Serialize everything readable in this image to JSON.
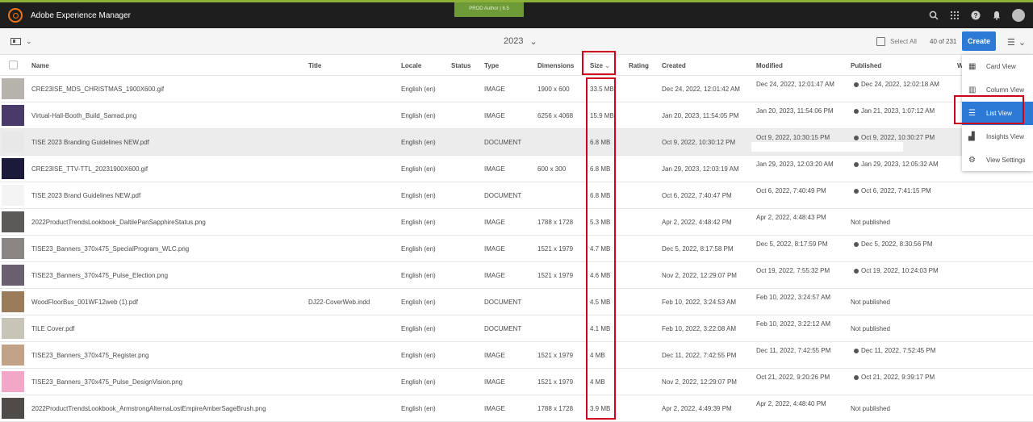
{
  "app": {
    "title": "Adobe Experience Manager",
    "env_badge": "PROD Author | 6.5"
  },
  "top_icons": [
    "search-icon",
    "apps-grid-icon",
    "help-icon",
    "bell-icon",
    "user-avatar"
  ],
  "actionbar": {
    "folder_title": "2023",
    "folder_chevron": "⌄",
    "rail_chevron": "⌄",
    "select_all_label": "Select All",
    "count_label": "40 of 231",
    "create_label": "Create",
    "view_chevron": "⌄"
  },
  "columns": {
    "name": "Name",
    "title": "Title",
    "locale": "Locale",
    "status": "Status",
    "type": "Type",
    "dimensions": "Dimensions",
    "size": "Size",
    "size_sort": "⌄",
    "rating": "Rating",
    "created": "Created",
    "modified": "Modified",
    "published": "Published",
    "workflow": "W"
  },
  "rows": [
    {
      "name": "CRE23ISE_MDS_CHRISTMAS_1900X600.gif",
      "title": "",
      "locale": "English (en)",
      "type": "IMAGE",
      "dimensions": "1900 x 600",
      "size": "33.5 MB",
      "created": "Dec 24, 2022, 12:01:42 AM",
      "modified": "Dec 24, 2022, 12:01:47 AM",
      "published": "Dec 24, 2022, 12:02:18 AM",
      "thumb": "#b8b2ad"
    },
    {
      "name": "Virtual-Hall-Booth_Build_Samad.png",
      "title": "",
      "locale": "English (en)",
      "type": "IMAGE",
      "dimensions": "6256 x 4068",
      "size": "15.9 MB",
      "created": "Jan 20, 2023, 11:54:05 PM",
      "modified": "Jan 20, 2023, 11:54:06 PM",
      "published": "Jan 21, 2023, 1:07:12 AM",
      "thumb": "#4a3a6a"
    },
    {
      "name": "TISE 2023 Branding Guidelines NEW.pdf",
      "title": "",
      "locale": "English (en)",
      "type": "DOCUMENT",
      "dimensions": "",
      "size": "6.8 MB",
      "created": "Oct 9, 2022, 10:30:12 PM",
      "modified": "Oct 9, 2022, 10:30:15 PM",
      "published": "Oct 9, 2022, 10:30:27 PM",
      "thumb": "#e8e8e8"
    },
    {
      "name": "CRE23ISE_TTV-TTL_20231900X600.gif",
      "title": "",
      "locale": "English (en)",
      "type": "IMAGE",
      "dimensions": "600 x 300",
      "size": "6.8 MB",
      "created": "Jan 29, 2023, 12:03:19 AM",
      "modified": "Jan 29, 2023, 12:03:20 AM",
      "published": "Jan 29, 2023, 12:05:32 AM",
      "thumb": "#1c1a3a"
    },
    {
      "name": "TISE 2023 Brand Guidelines NEW.pdf",
      "title": "",
      "locale": "English (en)",
      "type": "DOCUMENT",
      "dimensions": "",
      "size": "6.8 MB",
      "created": "Oct 6, 2022, 7:40:47 PM",
      "modified": "Oct 6, 2022, 7:40:49 PM",
      "published": "Oct 6, 2022, 7:41:15 PM",
      "thumb": "#f4f4f4"
    },
    {
      "name": "2022ProductTrendsLookbook_DaltilePanSapphireStatus.png",
      "title": "",
      "locale": "English (en)",
      "type": "IMAGE",
      "dimensions": "1788 x 1728",
      "size": "5.3 MB",
      "created": "Apr 2, 2022, 4:48:42 PM",
      "modified": "Apr 2, 2022, 4:48:43 PM",
      "published": "Not published",
      "thumb": "#5c5a58"
    },
    {
      "name": "TISE23_Banners_370x475_SpecialProgram_WLC.png",
      "title": "",
      "locale": "English (en)",
      "type": "IMAGE",
      "dimensions": "1521 x 1979",
      "size": "4.7 MB",
      "created": "Dec 5, 2022, 8:17:58 PM",
      "modified": "Dec 5, 2022, 8:17:59 PM",
      "published": "Dec 5, 2022, 8:30:56 PM",
      "thumb": "#8a8684"
    },
    {
      "name": "TISE23_Banners_370x475_Pulse_Election.png",
      "title": "",
      "locale": "English (en)",
      "type": "IMAGE",
      "dimensions": "1521 x 1979",
      "size": "4.6 MB",
      "created": "Nov 2, 2022, 12:29:07 PM",
      "modified": "Oct 19, 2022, 7:55:32 PM",
      "published": "Oct 19, 2022, 10:24:03 PM",
      "thumb": "#6a5f6e"
    },
    {
      "name": "WoodFloorBus_001WF12web (1).pdf",
      "title": "DJ22-CoverWeb.indd",
      "locale": "English (en)",
      "type": "DOCUMENT",
      "dimensions": "",
      "size": "4.5 MB",
      "created": "Feb 10, 2022, 3:24:53 AM",
      "modified": "Feb 10, 2022, 3:24:57 AM",
      "published": "Not published",
      "thumb": "#9a7b5a"
    },
    {
      "name": "TILE Cover.pdf",
      "title": "",
      "locale": "English (en)",
      "type": "DOCUMENT",
      "dimensions": "",
      "size": "4.1 MB",
      "created": "Feb 10, 2022, 3:22:08 AM",
      "modified": "Feb 10, 2022, 3:22:12 AM",
      "published": "Not published",
      "thumb": "#c9c4b8"
    },
    {
      "name": "TISE23_Banners_370x475_Register.png",
      "title": "",
      "locale": "English (en)",
      "type": "IMAGE",
      "dimensions": "1521 x 1979",
      "size": "4 MB",
      "created": "Dec 11, 2022, 7:42:55 PM",
      "modified": "Dec 11, 2022, 7:42:55 PM",
      "published": "Dec 11, 2022, 7:52:45 PM",
      "thumb": "#c2a286"
    },
    {
      "name": "TISE23_Banners_370x475_Pulse_DesignVision.png",
      "title": "",
      "locale": "English (en)",
      "type": "IMAGE",
      "dimensions": "1521 x 1979",
      "size": "4 MB",
      "created": "Nov 2, 2022, 12:29:07 PM",
      "modified": "Oct 21, 2022, 9:20:26 PM",
      "published": "Oct 21, 2022, 9:39:17 PM",
      "thumb": "#f2a7c9"
    },
    {
      "name": "2022ProductTrendsLookbook_ArmstrongAlternaLostEmpireAmberSageBrush.png",
      "title": "",
      "locale": "English (en)",
      "type": "IMAGE",
      "dimensions": "1788 x 1728",
      "size": "3.9 MB",
      "created": "Apr 2, 2022, 4:49:39 PM",
      "modified": "Apr 2, 2022, 4:48:40 PM",
      "published": "Not published",
      "thumb": "#4e4b48"
    }
  ],
  "view_menu": [
    {
      "label": "Card View",
      "icon": "card-view-icon",
      "glyph": "▦",
      "selected": false
    },
    {
      "label": "Column View",
      "icon": "column-view-icon",
      "glyph": "▥",
      "selected": false
    },
    {
      "label": "List View",
      "icon": "list-view-icon",
      "glyph": "☰",
      "selected": true
    },
    {
      "label": "Insights View",
      "icon": "insights-view-icon",
      "glyph": "▟",
      "selected": false
    },
    {
      "label": "View Settings",
      "icon": "gear-icon",
      "glyph": "⚙",
      "selected": false
    }
  ],
  "colors": {
    "accent": "#2c7ad6",
    "highlight_red": "#d0021b",
    "topbar": "#1e1e1e",
    "env_badge": "#6e9b38"
  }
}
